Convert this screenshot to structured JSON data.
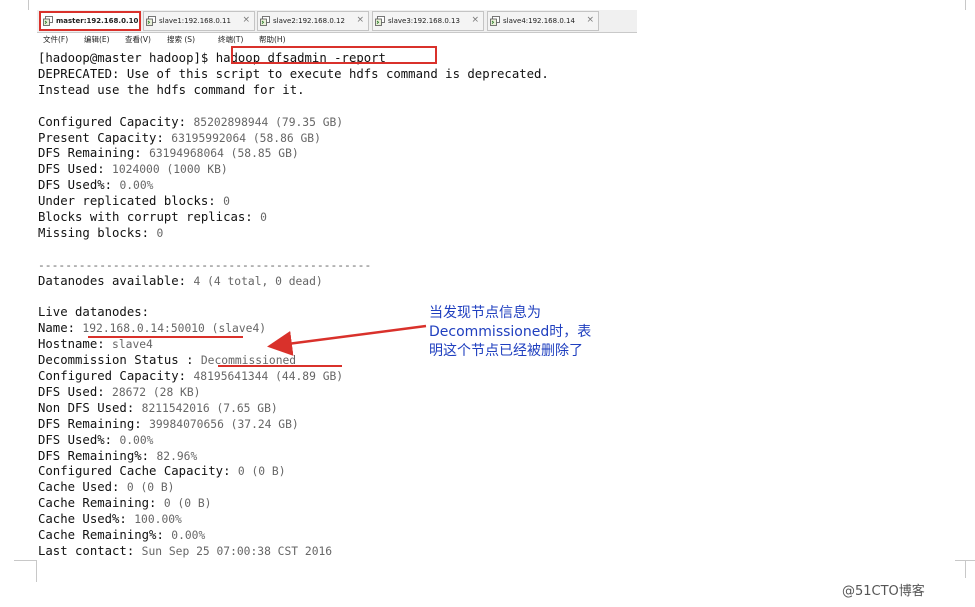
{
  "tabs": [
    {
      "label": "master:192.168.0.10",
      "active": true
    },
    {
      "label": "slave1:192.168.0.11",
      "active": false
    },
    {
      "label": "slave2:192.168.0.12",
      "active": false
    },
    {
      "label": "slave3:192.168.0.13",
      "active": false
    },
    {
      "label": "slave4:192.168.0.14",
      "active": false
    }
  ],
  "tab_close": "×",
  "menu": [
    "文件(F)",
    "编辑(E)",
    "查看(V)",
    "搜索 (S)",
    "终端(T)",
    "帮助(H)"
  ],
  "terminal": {
    "prompt": "[hadoop@master hadoop]$ ",
    "command": "hadoop dfsadmin -report",
    "lines": [
      {
        "k": "DEPRECATED: Use of this script to execute hdfs command is deprecated.",
        "v": ""
      },
      {
        "k": "Instead use the hdfs command for it.",
        "v": ""
      },
      {
        "k": "",
        "v": ""
      },
      {
        "k": "Configured Capacity: ",
        "v": "85202898944 (79.35 GB)"
      },
      {
        "k": "Present Capacity: ",
        "v": "63195992064 (58.86 GB)"
      },
      {
        "k": "DFS Remaining: ",
        "v": "63194968064 (58.85 GB)"
      },
      {
        "k": "DFS Used: ",
        "v": "1024000 (1000 KB)"
      },
      {
        "k": "DFS Used%: ",
        "v": "0.00%"
      },
      {
        "k": "Under replicated blocks: ",
        "v": "0"
      },
      {
        "k": "Blocks with corrupt replicas: ",
        "v": "0"
      },
      {
        "k": "Missing blocks: ",
        "v": "0"
      },
      {
        "k": "",
        "v": ""
      },
      {
        "k": "",
        "v": "-------------------------------------------------"
      },
      {
        "k": "Datanodes available: ",
        "v": "4 (4 total, 0 dead)"
      },
      {
        "k": "",
        "v": ""
      },
      {
        "k": "Live datanodes:",
        "v": ""
      },
      {
        "k": "Name: ",
        "v": "192.168.0.14:50010 (slave4)"
      },
      {
        "k": "Hostname: ",
        "v": "slave4"
      },
      {
        "k": "Decommission Status : ",
        "v": "Decommissioned"
      },
      {
        "k": "Configured Capacity: ",
        "v": "48195641344 (44.89 GB)"
      },
      {
        "k": "DFS Used: ",
        "v": "28672 (28 KB)"
      },
      {
        "k": "Non DFS Used: ",
        "v": "8211542016 (7.65 GB)"
      },
      {
        "k": "DFS Remaining: ",
        "v": "39984070656 (37.24 GB)"
      },
      {
        "k": "DFS Used%: ",
        "v": "0.00%"
      },
      {
        "k": "DFS Remaining%: ",
        "v": "82.96%"
      },
      {
        "k": "Configured Cache Capacity: ",
        "v": "0 (0 B)"
      },
      {
        "k": "Cache Used: ",
        "v": "0 (0 B)"
      },
      {
        "k": "Cache Remaining: ",
        "v": "0 (0 B)"
      },
      {
        "k": "Cache Used%: ",
        "v": "100.00%"
      },
      {
        "k": "Cache Remaining%: ",
        "v": "0.00%"
      },
      {
        "k": "Last contact: ",
        "v": "Sun Sep 25 07:00:38 CST 2016"
      }
    ]
  },
  "annotation": {
    "lines": [
      "当发现节点信息为",
      "Decommissioned时，表",
      "明这个节点已经被删除了"
    ],
    "color": "#1f3fbf"
  },
  "highlight_color": "#d9312b",
  "watermark": "@51CTO博客"
}
